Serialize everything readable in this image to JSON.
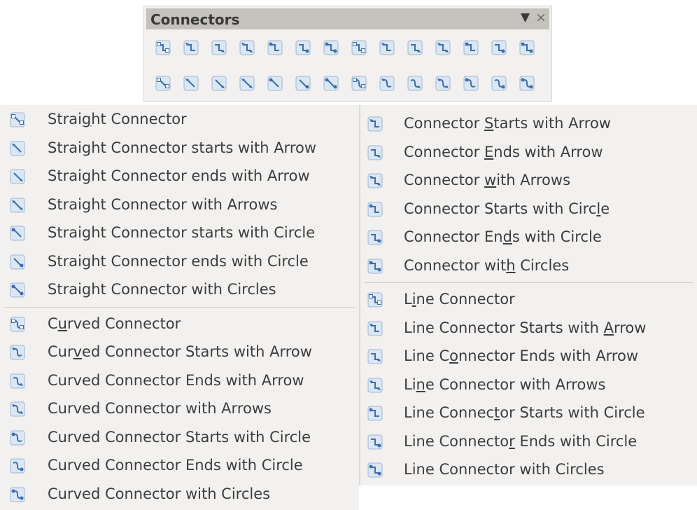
{
  "toolbar": {
    "title": "Connectors",
    "row1": [
      "connector-standard",
      "connector-starts-arrow",
      "connector-ends-arrow",
      "connector-arrows",
      "connector-starts-circle",
      "connector-ends-circle",
      "connector-circles",
      "line-connector",
      "line-connector-starts-arrow",
      "line-connector-ends-arrow",
      "line-connector-arrows",
      "line-connector-starts-circle",
      "line-connector-ends-circle",
      "line-connector-circles"
    ],
    "row2": [
      "straight-connector",
      "straight-starts-arrow",
      "straight-ends-arrow",
      "straight-arrows",
      "straight-starts-circle",
      "straight-ends-circle",
      "straight-circles",
      "curved-connector",
      "curved-starts-arrow",
      "curved-ends-arrow",
      "curved-arrows",
      "curved-starts-circle",
      "curved-ends-circle",
      "curved-circles"
    ]
  },
  "left_menu": {
    "group1": [
      {
        "pre": "Strai",
        "u": "g",
        "post": "ht Connector",
        "icon": "straight-connector-icon"
      },
      {
        "pre": "Straight Connector starts with Arrow",
        "u": "",
        "post": "",
        "icon": "straight-starts-arrow-icon"
      },
      {
        "pre": "Straight Connector ends with Arrow",
        "u": "",
        "post": "",
        "icon": "straight-ends-arrow-icon"
      },
      {
        "pre": "Straight Connector with Arrows",
        "u": "",
        "post": "",
        "icon": "straight-arrows-icon"
      },
      {
        "pre": "Straight Connector starts with Circle",
        "u": "",
        "post": "",
        "icon": "straight-starts-circle-icon"
      },
      {
        "pre": "Straight Connector ends with Circle",
        "u": "",
        "post": "",
        "icon": "straight-ends-circle-icon"
      },
      {
        "pre": "Straight Connector with Circles",
        "u": "",
        "post": "",
        "icon": "straight-circles-icon"
      }
    ],
    "group2": [
      {
        "pre": "C",
        "u": "u",
        "post": "rved Connector",
        "icon": "curved-connector-icon"
      },
      {
        "pre": "Cur",
        "u": "v",
        "post": "ed Connector Starts with Arrow",
        "icon": "curved-starts-arrow-icon"
      },
      {
        "pre": "Curved Connector Ends with Arrow",
        "u": "",
        "post": "",
        "icon": "curved-ends-arrow-icon"
      },
      {
        "pre": "Curved Connector with Arrows",
        "u": "",
        "post": "",
        "icon": "curved-arrows-icon"
      },
      {
        "pre": "Curved Connector Starts with Circle",
        "u": "",
        "post": "",
        "icon": "curved-starts-circle-icon"
      },
      {
        "pre": "Curved Connector Ends with Circle",
        "u": "",
        "post": "",
        "icon": "curved-ends-circle-icon"
      },
      {
        "pre": "Curved Connector with Circles",
        "u": "",
        "post": "",
        "icon": "curved-circles-icon"
      }
    ]
  },
  "right_menu": {
    "group1": [
      {
        "pre": "Connector ",
        "u": "S",
        "post": "tarts with Arrow",
        "icon": "connector-starts-arrow-icon"
      },
      {
        "pre": "Connector ",
        "u": "E",
        "post": "nds with Arrow",
        "icon": "connector-ends-arrow-icon"
      },
      {
        "pre": "Connector ",
        "u": "w",
        "post": "ith Arrows",
        "icon": "connector-arrows-icon"
      },
      {
        "pre": "Connector Starts with Circ",
        "u": "l",
        "post": "e",
        "icon": "connector-starts-circle-icon"
      },
      {
        "pre": "Connector En",
        "u": "d",
        "post": "s with Circle",
        "icon": "connector-ends-circle-icon"
      },
      {
        "pre": "Connector wit",
        "u": "h",
        "post": " Circles",
        "icon": "connector-circles-icon"
      }
    ],
    "group2": [
      {
        "pre": "L",
        "u": "i",
        "post": "ne Connector",
        "icon": "line-connector-icon"
      },
      {
        "pre": "Line Connector Starts with ",
        "u": "A",
        "post": "rrow",
        "icon": "line-starts-arrow-icon"
      },
      {
        "pre": "Line C",
        "u": "o",
        "post": "nnector Ends with Arrow",
        "icon": "line-ends-arrow-icon"
      },
      {
        "pre": "Li",
        "u": "n",
        "post": "e Connector with Arrows",
        "icon": "line-arrows-icon"
      },
      {
        "pre": "Line Connec",
        "u": "t",
        "post": "or Starts with Circle",
        "icon": "line-starts-circle-icon"
      },
      {
        "pre": "Line Connecto",
        "u": "r",
        "post": " Ends with Circle",
        "icon": "line-ends-circle-icon"
      },
      {
        "pre": "Line Connector with Circles",
        "u": "",
        "post": "",
        "icon": "line-circles-icon"
      }
    ]
  },
  "colors": {
    "icon_blue": "#3d6fb0",
    "icon_bg": "#dce7f4",
    "title_bg": "#c5c2bd",
    "panel_bg": "#f2f1f0"
  }
}
